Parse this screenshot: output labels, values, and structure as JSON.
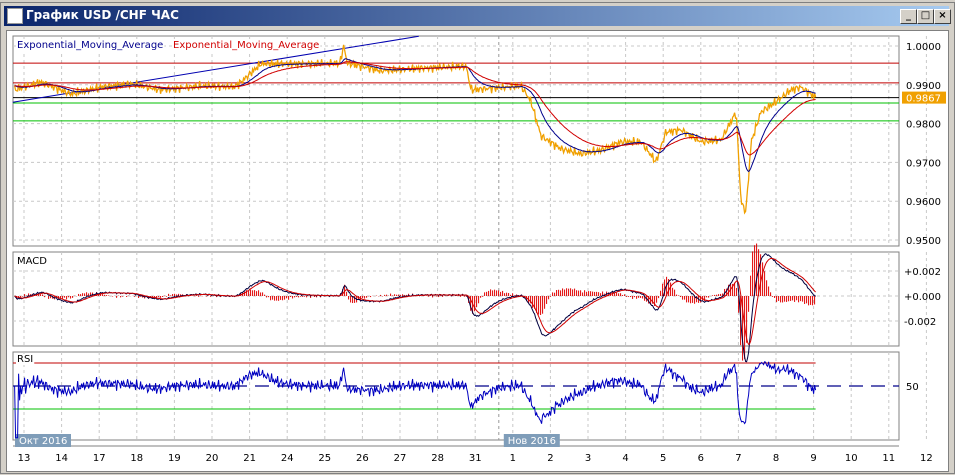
{
  "window": {
    "title": "График USD /CHF  ЧАС",
    "min_label": "_",
    "max_label": "□",
    "close_label": "×"
  },
  "legend": {
    "ema1": "Exponential_Moving_Average",
    "ema2": "Exponential_Moving_Average"
  },
  "colors": {
    "price": "#f0a000",
    "ema_fast": "#00008b",
    "ema_slow": "#d00000",
    "macd": "#000040",
    "signal": "#d00000",
    "rsi": "#0000c0",
    "upper": "#c00000",
    "lower": "#00c000"
  },
  "chart_data": [
    {
      "type": "line",
      "title": "USD/CHF H1",
      "ylim": [
        0.945,
        1.003
      ],
      "yticks": [
        "1.0000",
        "0.9900",
        "0.9800",
        "0.9700",
        "0.9600",
        "0.9500"
      ],
      "ytick_values": [
        1.0,
        0.99,
        0.98,
        0.97,
        0.96,
        0.95
      ],
      "current_price": "0.9867",
      "hlines": [
        {
          "value": 0.9956,
          "color": "red"
        },
        {
          "value": 0.9905,
          "color": "red"
        },
        {
          "value": 0.9867,
          "color": "black"
        },
        {
          "value": 0.9853,
          "color": "green"
        },
        {
          "value": 0.9807,
          "color": "green"
        }
      ],
      "trendline": [
        [
          -0.3,
          0.9855
        ],
        [
          10.5,
          1.0025
        ]
      ],
      "x_labels": [
        "13",
        "14",
        "17",
        "18",
        "19",
        "20",
        "21",
        "24",
        "25",
        "26",
        "27",
        "28",
        "31",
        "1",
        "2",
        "3",
        "4",
        "5",
        "6",
        "7",
        "8",
        "9",
        "10",
        "11",
        "12",
        "13"
      ],
      "month_labels": [
        {
          "label": "Окт 2016",
          "index": 0
        },
        {
          "label": "Нов 2016",
          "index": 13
        }
      ],
      "price": [
        [
          -0.25,
          0.9887
        ],
        [
          0.45,
          0.9907
        ],
        [
          1.25,
          0.9876
        ],
        [
          2.05,
          0.9894
        ],
        [
          2.85,
          0.9902
        ],
        [
          3.64,
          0.9887
        ],
        [
          4.71,
          0.9897
        ],
        [
          5.6,
          0.9895
        ],
        [
          5.77,
          0.9907
        ],
        [
          6.3,
          0.9954
        ],
        [
          7.37,
          0.9954
        ],
        [
          8.4,
          0.9955
        ],
        [
          8.5,
          1.0
        ],
        [
          8.6,
          0.9956
        ],
        [
          9.49,
          0.9936
        ],
        [
          10.56,
          0.9943
        ],
        [
          11.76,
          0.9948
        ],
        [
          11.89,
          0.9887
        ],
        [
          13.22,
          0.9897
        ],
        [
          13.48,
          0.9858
        ],
        [
          13.75,
          0.9768
        ],
        [
          14.28,
          0.9735
        ],
        [
          14.81,
          0.9722
        ],
        [
          15.35,
          0.9732
        ],
        [
          15.88,
          0.9753
        ],
        [
          16.41,
          0.9753
        ],
        [
          16.81,
          0.9701
        ],
        [
          17.07,
          0.9778
        ],
        [
          17.47,
          0.9784
        ],
        [
          18.01,
          0.9753
        ],
        [
          18.54,
          0.9758
        ],
        [
          18.94,
          0.983
        ],
        [
          19.07,
          0.9598
        ],
        [
          19.2,
          0.9572
        ],
        [
          19.34,
          0.9753
        ],
        [
          19.6,
          0.983
        ],
        [
          20.0,
          0.9856
        ],
        [
          20.4,
          0.9887
        ],
        [
          20.66,
          0.9894
        ],
        [
          21.06,
          0.9867
        ]
      ]
    },
    {
      "type": "line",
      "title": "MACD",
      "ylim": [
        -0.0038,
        0.0035
      ],
      "yticks": [
        "+0.002",
        "+0.000",
        "-0.002"
      ],
      "ytick_values": [
        0.002,
        0,
        -0.002
      ]
    },
    {
      "type": "line",
      "title": "RSI",
      "ylim": [
        0,
        100
      ],
      "yticks": [
        "50"
      ],
      "ytick_values": [
        50
      ],
      "levels": [
        70,
        50,
        30
      ]
    }
  ]
}
